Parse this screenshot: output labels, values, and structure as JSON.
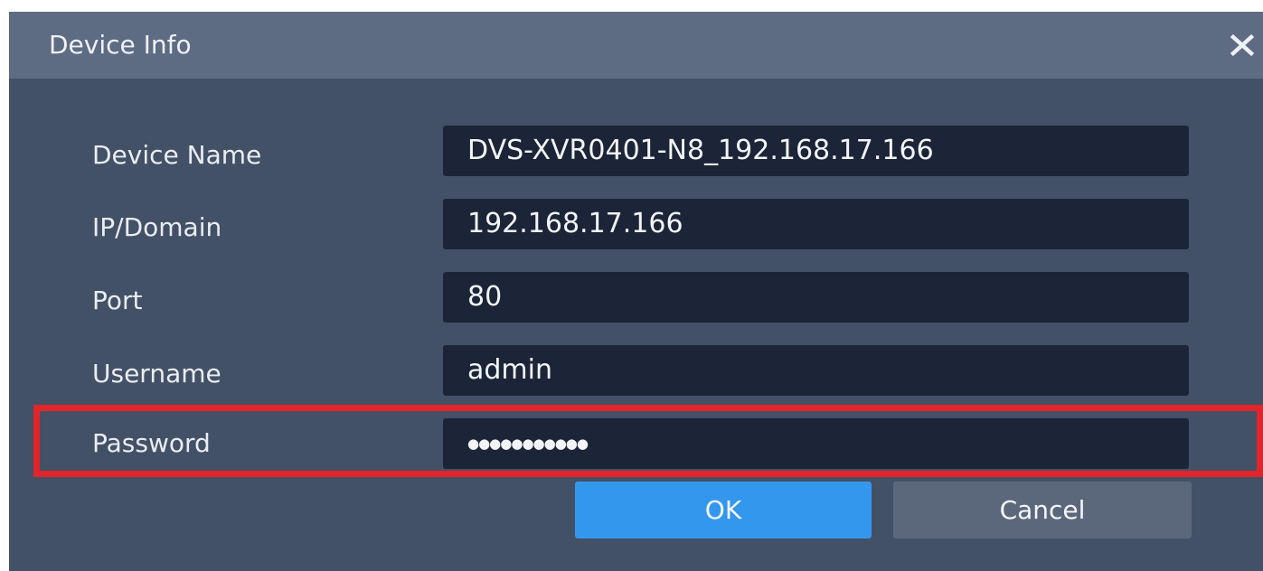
{
  "dialog": {
    "title": "Device Info",
    "close_icon": "close-icon"
  },
  "form": {
    "device_name": {
      "label": "Device Name",
      "value": "DVS-XVR0401-N8_192.168.17.166"
    },
    "ip_domain": {
      "label": "IP/Domain",
      "value": "192.168.17.166"
    },
    "port": {
      "label": "Port",
      "value": "80"
    },
    "username": {
      "label": "Username",
      "value": "admin"
    },
    "password": {
      "label": "Password",
      "value": "●●●●●●●●●●●"
    }
  },
  "buttons": {
    "ok": "OK",
    "cancel": "Cancel"
  },
  "colors": {
    "titlebar": "#5d6c82",
    "body": "#435166",
    "field": "#1b2537",
    "ok_button": "#3497ee",
    "cancel_button": "#5b687c",
    "highlight": "#e3242b"
  }
}
